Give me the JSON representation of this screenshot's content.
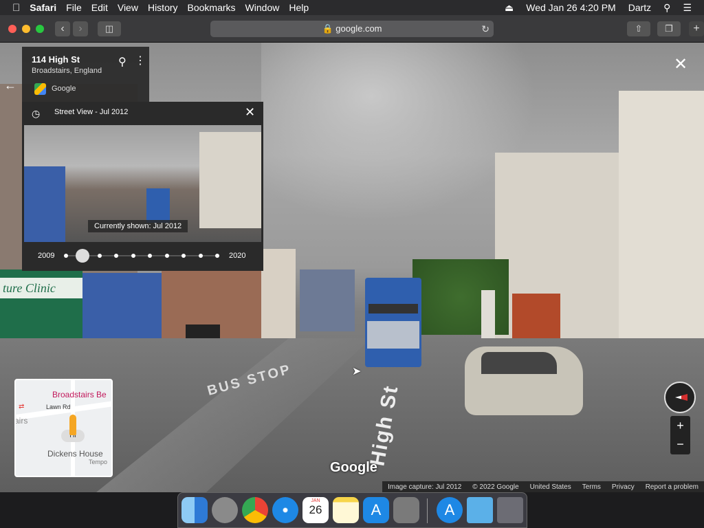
{
  "menubar": {
    "app": "Safari",
    "items": [
      "File",
      "Edit",
      "View",
      "History",
      "Bookmarks",
      "Window",
      "Help"
    ],
    "datetime": "Wed Jan 26  4:20 PM",
    "user": "Dartz"
  },
  "browser": {
    "url": "google.com"
  },
  "place": {
    "title": "114 High St",
    "subtitle": "Broadstairs, England",
    "source": "Google"
  },
  "streetview": {
    "header": "Street View - Jul 2012",
    "current_label": "Currently shown: Jul 2012",
    "year_start": "2009",
    "year_end": "2020",
    "ticks": 10,
    "selected_index": 1
  },
  "minimap": {
    "label_top": "Broadstairs Be",
    "label_road": "Lawn Rd",
    "label_bottom": "Dickens House",
    "label_bottom2": "Tempo",
    "label_left": "airs",
    "label_hi": "Hi"
  },
  "scene": {
    "road_text": "High St",
    "bus_stop_text": "BUS STOP",
    "clinic_text": "ture Clinic",
    "watermark": "Google"
  },
  "footer": {
    "capture": "Image capture: Jul 2012",
    "copyright": "© 2022 Google",
    "region": "United States",
    "terms": "Terms",
    "privacy": "Privacy",
    "report": "Report a problem"
  },
  "dock_apps": [
    "Finder",
    "Launchpad",
    "Chrome",
    "Safari",
    "Calendar",
    "Notes",
    "App Store",
    "System Preferences",
    "App Store Folder",
    "Downloads",
    "Trash"
  ],
  "calendar_icon": {
    "month": "JAN",
    "day": "26"
  }
}
